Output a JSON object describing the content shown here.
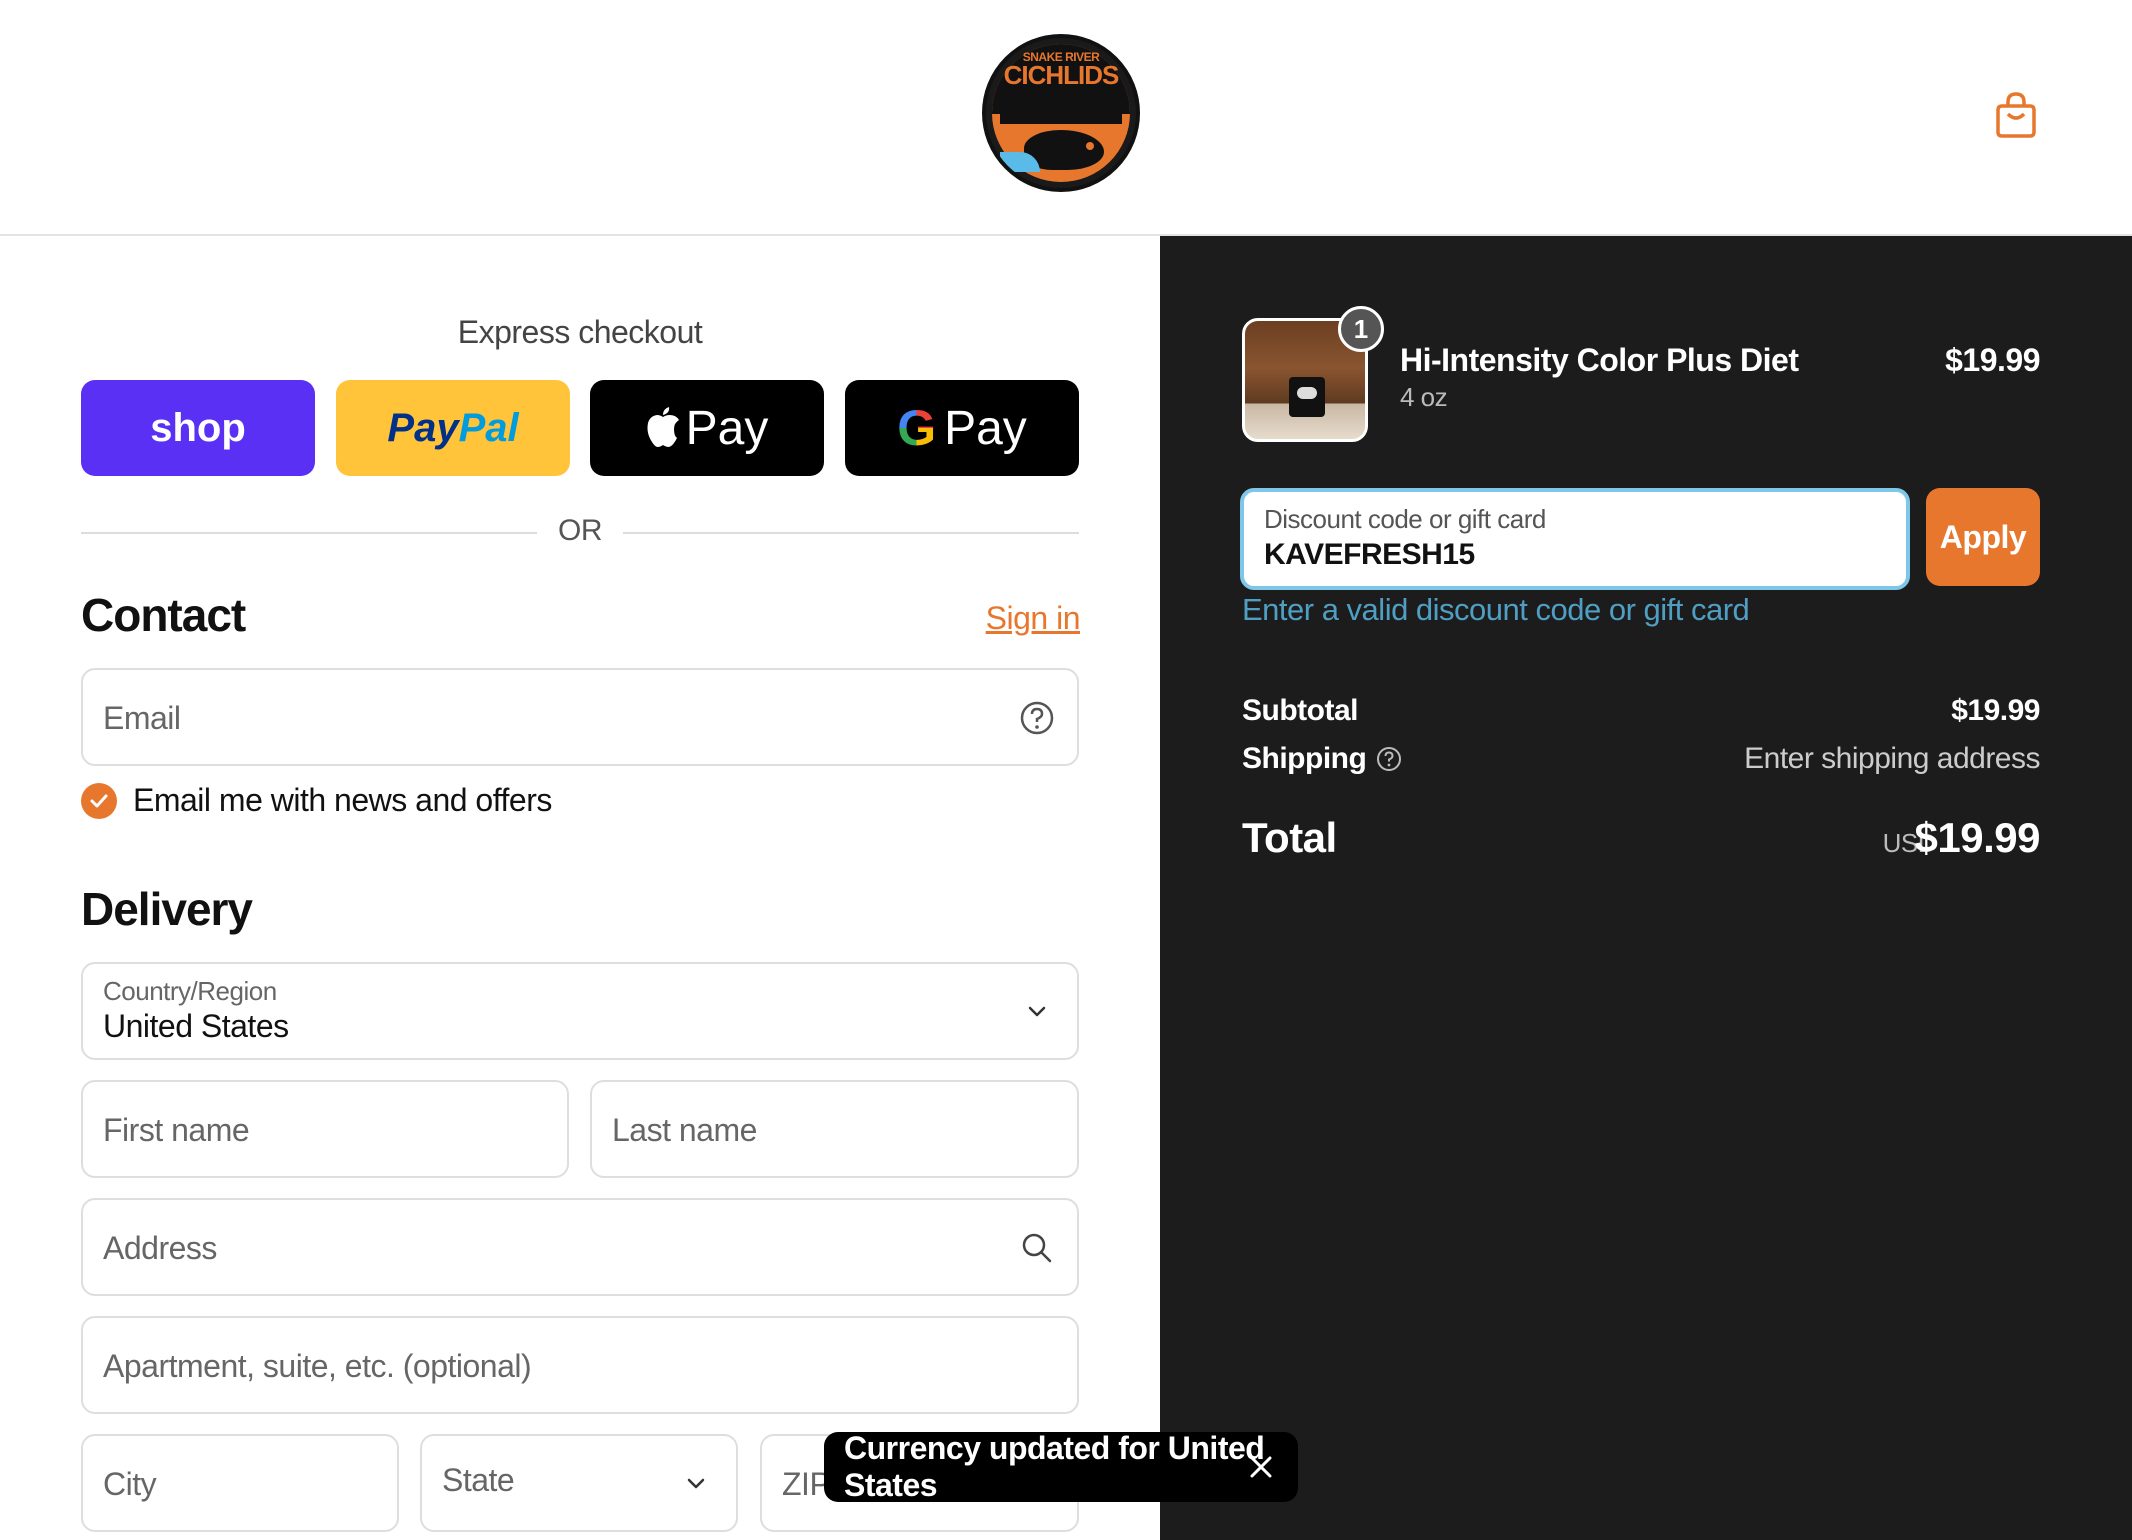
{
  "header": {
    "logo_top": "SNAKE RIVER",
    "logo_main": "CICHLIDS",
    "cart_icon": "shopping-bag-icon"
  },
  "express": {
    "title": "Express checkout",
    "shop_label": "shop",
    "paypal_label_1": "Pay",
    "paypal_label_2": "Pal",
    "apple_label": "Pay",
    "google_label": "Pay",
    "or_label": "OR"
  },
  "contact": {
    "title": "Contact",
    "sign_in": "Sign in",
    "email_placeholder": "Email",
    "newsletter_label": "Email me with news and offers",
    "newsletter_checked": true
  },
  "delivery": {
    "title": "Delivery",
    "country_label": "Country/Region",
    "country_value": "United States",
    "first_name_placeholder": "First name",
    "last_name_placeholder": "Last name",
    "address_placeholder": "Address",
    "apartment_placeholder": "Apartment, suite, etc. (optional)",
    "city_placeholder": "City",
    "state_placeholder": "State",
    "zip_placeholder": "ZIP code"
  },
  "order": {
    "item": {
      "name": "Hi-Intensity Color Plus Diet",
      "variant": "4 oz",
      "price": "$19.99",
      "quantity": "1"
    },
    "discount_label": "Discount code or gift card",
    "discount_value": "KAVEFRESH15",
    "apply_label": "Apply",
    "discount_error": "Enter a valid discount code or gift card",
    "subtotal_label": "Subtotal",
    "subtotal_value": "$19.99",
    "shipping_label": "Shipping",
    "shipping_value": "Enter shipping address",
    "total_label": "Total",
    "total_currency": "USD",
    "total_value": "$19.99"
  },
  "toast": {
    "message": "Currency updated for United States"
  },
  "colors": {
    "accent": "#e8772e",
    "summary_bg": "#1c1c1c",
    "error_text": "#4f9ec4",
    "shop_pay": "#5a31f4",
    "paypal": "#ffc439"
  }
}
